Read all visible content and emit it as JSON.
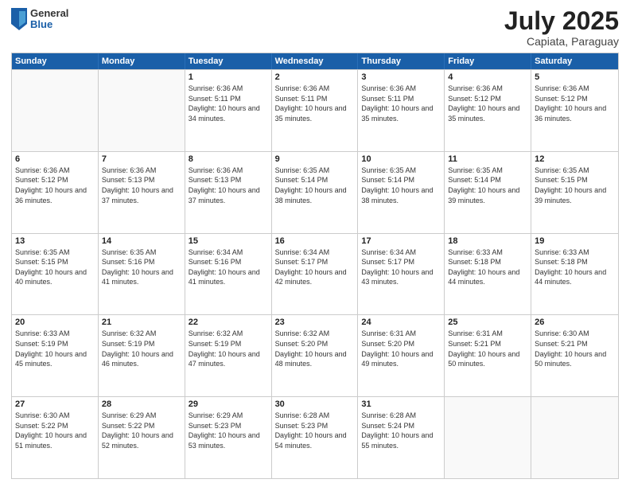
{
  "header": {
    "logo": {
      "general": "General",
      "blue": "Blue"
    },
    "title": "July 2025",
    "location": "Capiata, Paraguay"
  },
  "calendar": {
    "weekdays": [
      "Sunday",
      "Monday",
      "Tuesday",
      "Wednesday",
      "Thursday",
      "Friday",
      "Saturday"
    ],
    "weeks": [
      [
        {
          "day": "",
          "empty": true
        },
        {
          "day": "",
          "empty": true
        },
        {
          "day": "1",
          "sunrise": "6:36 AM",
          "sunset": "5:11 PM",
          "daylight": "10 hours and 34 minutes."
        },
        {
          "day": "2",
          "sunrise": "6:36 AM",
          "sunset": "5:11 PM",
          "daylight": "10 hours and 35 minutes."
        },
        {
          "day": "3",
          "sunrise": "6:36 AM",
          "sunset": "5:11 PM",
          "daylight": "10 hours and 35 minutes."
        },
        {
          "day": "4",
          "sunrise": "6:36 AM",
          "sunset": "5:12 PM",
          "daylight": "10 hours and 35 minutes."
        },
        {
          "day": "5",
          "sunrise": "6:36 AM",
          "sunset": "5:12 PM",
          "daylight": "10 hours and 36 minutes."
        }
      ],
      [
        {
          "day": "6",
          "sunrise": "6:36 AM",
          "sunset": "5:12 PM",
          "daylight": "10 hours and 36 minutes."
        },
        {
          "day": "7",
          "sunrise": "6:36 AM",
          "sunset": "5:13 PM",
          "daylight": "10 hours and 37 minutes."
        },
        {
          "day": "8",
          "sunrise": "6:36 AM",
          "sunset": "5:13 PM",
          "daylight": "10 hours and 37 minutes."
        },
        {
          "day": "9",
          "sunrise": "6:35 AM",
          "sunset": "5:14 PM",
          "daylight": "10 hours and 38 minutes."
        },
        {
          "day": "10",
          "sunrise": "6:35 AM",
          "sunset": "5:14 PM",
          "daylight": "10 hours and 38 minutes."
        },
        {
          "day": "11",
          "sunrise": "6:35 AM",
          "sunset": "5:14 PM",
          "daylight": "10 hours and 39 minutes."
        },
        {
          "day": "12",
          "sunrise": "6:35 AM",
          "sunset": "5:15 PM",
          "daylight": "10 hours and 39 minutes."
        }
      ],
      [
        {
          "day": "13",
          "sunrise": "6:35 AM",
          "sunset": "5:15 PM",
          "daylight": "10 hours and 40 minutes."
        },
        {
          "day": "14",
          "sunrise": "6:35 AM",
          "sunset": "5:16 PM",
          "daylight": "10 hours and 41 minutes."
        },
        {
          "day": "15",
          "sunrise": "6:34 AM",
          "sunset": "5:16 PM",
          "daylight": "10 hours and 41 minutes."
        },
        {
          "day": "16",
          "sunrise": "6:34 AM",
          "sunset": "5:17 PM",
          "daylight": "10 hours and 42 minutes."
        },
        {
          "day": "17",
          "sunrise": "6:34 AM",
          "sunset": "5:17 PM",
          "daylight": "10 hours and 43 minutes."
        },
        {
          "day": "18",
          "sunrise": "6:33 AM",
          "sunset": "5:18 PM",
          "daylight": "10 hours and 44 minutes."
        },
        {
          "day": "19",
          "sunrise": "6:33 AM",
          "sunset": "5:18 PM",
          "daylight": "10 hours and 44 minutes."
        }
      ],
      [
        {
          "day": "20",
          "sunrise": "6:33 AM",
          "sunset": "5:19 PM",
          "daylight": "10 hours and 45 minutes."
        },
        {
          "day": "21",
          "sunrise": "6:32 AM",
          "sunset": "5:19 PM",
          "daylight": "10 hours and 46 minutes."
        },
        {
          "day": "22",
          "sunrise": "6:32 AM",
          "sunset": "5:19 PM",
          "daylight": "10 hours and 47 minutes."
        },
        {
          "day": "23",
          "sunrise": "6:32 AM",
          "sunset": "5:20 PM",
          "daylight": "10 hours and 48 minutes."
        },
        {
          "day": "24",
          "sunrise": "6:31 AM",
          "sunset": "5:20 PM",
          "daylight": "10 hours and 49 minutes."
        },
        {
          "day": "25",
          "sunrise": "6:31 AM",
          "sunset": "5:21 PM",
          "daylight": "10 hours and 50 minutes."
        },
        {
          "day": "26",
          "sunrise": "6:30 AM",
          "sunset": "5:21 PM",
          "daylight": "10 hours and 50 minutes."
        }
      ],
      [
        {
          "day": "27",
          "sunrise": "6:30 AM",
          "sunset": "5:22 PM",
          "daylight": "10 hours and 51 minutes."
        },
        {
          "day": "28",
          "sunrise": "6:29 AM",
          "sunset": "5:22 PM",
          "daylight": "10 hours and 52 minutes."
        },
        {
          "day": "29",
          "sunrise": "6:29 AM",
          "sunset": "5:23 PM",
          "daylight": "10 hours and 53 minutes."
        },
        {
          "day": "30",
          "sunrise": "6:28 AM",
          "sunset": "5:23 PM",
          "daylight": "10 hours and 54 minutes."
        },
        {
          "day": "31",
          "sunrise": "6:28 AM",
          "sunset": "5:24 PM",
          "daylight": "10 hours and 55 minutes."
        },
        {
          "day": "",
          "empty": true
        },
        {
          "day": "",
          "empty": true
        }
      ]
    ]
  }
}
